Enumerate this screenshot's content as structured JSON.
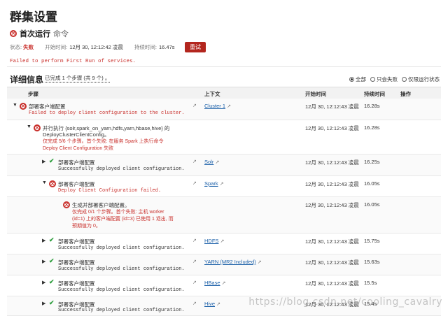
{
  "page": {
    "title": "群集设置",
    "command_name": "首次运行",
    "command_type": "命令",
    "status_label": "状态:",
    "status_value": "失败",
    "start_label": "开始时间:",
    "start_value": "12月 30, 12:12:42 凌晨",
    "duration_label": "持续时间:",
    "duration_value": "16.47s",
    "retry_button": "重试",
    "failure_message": "Failed to perform First Run of services."
  },
  "details": {
    "title": "详细信息",
    "progress": "已完成 1 个步骤 (共 9 个) 。",
    "filters": [
      "全部",
      "只会失败",
      "仅限运行状态"
    ],
    "columns": [
      "步骤",
      "上下文",
      "开始时间",
      "持续时间",
      "操作"
    ]
  },
  "rows": [
    {
      "title": "部署客户端配置",
      "msg": "Failed to deploy client configuration to the cluster.",
      "context": "Cluster 1",
      "start": "12月 30, 12:12:43 凌晨",
      "duration": "16.28s"
    },
    {
      "title": "并行执行 {solr,spark_on_yarn,hdfs,yarn,hbase,hive} 的",
      "title2": "DeployClusterClientConfig。",
      "msg": "仅完成 5/6 个步骤。首个失败: 在服务 Spark 上执行命令",
      "msg2": "Deploy Client Configuration 失败",
      "start": "12月 30, 12:12:43 凌晨",
      "duration": "16.28s"
    },
    {
      "title": "部署客户端配置",
      "msg": "Successfully deployed client configuration.",
      "context": "Solr",
      "start": "12月 30, 12:12:43 凌晨",
      "duration": "16.25s"
    },
    {
      "title": "部署客户端配置",
      "msg": "Deploy Client Configuration failed.",
      "context": "Spark",
      "start": "12月 30, 12:12:43 凌晨",
      "duration": "16.05s"
    },
    {
      "title": "生成并部署客户端配置。",
      "msg": "仅完成 0/1 个步骤。首个失败: 主机 worker",
      "msg2": "(id=1) 上的客户端配置 (id=3) 已使用 1 退出, 而",
      "msg3": "预期值为 0。",
      "start": "12月 30, 12:12:43 凌晨",
      "duration": "16.05s"
    },
    {
      "title": "部署客户端配置",
      "msg": "Successfully deployed client configuration.",
      "context": "HDFS",
      "start": "12月 30, 12:12:43 凌晨",
      "duration": "15.75s"
    },
    {
      "title": "部署客户端配置",
      "msg": "Successfully deployed client configuration.",
      "context": "YARN (MR2 Included)",
      "start": "12月 30, 12:12:43 凌晨",
      "duration": "15.63s"
    },
    {
      "title": "部署客户端配置",
      "msg": "Successfully deployed client configuration.",
      "context": "HBase",
      "start": "12月 30, 12:12:43 凌晨",
      "duration": "15.5s"
    },
    {
      "title": "部署客户端配置",
      "msg": "Successfully deployed client configuration.",
      "context": "Hive",
      "start": "12月 30, 12:12:43 凌晨",
      "duration": "15.4s"
    }
  ],
  "watermark": "https://blog.csdn.net/cooling_cavalry",
  "colors": {
    "error": "#c9302c",
    "success": "#2e9e3e",
    "link": "#1a5fa8",
    "button": "#b3261e"
  }
}
